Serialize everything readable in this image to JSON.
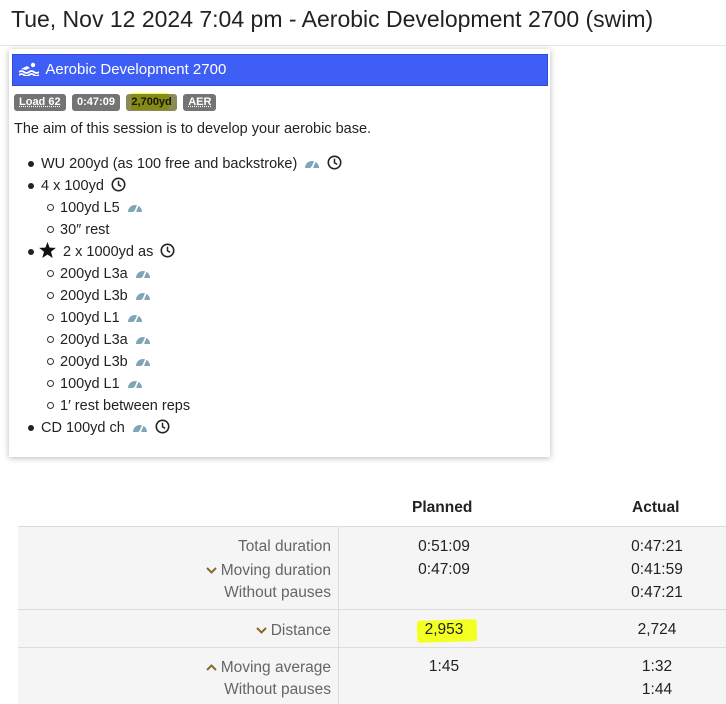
{
  "page": {
    "title": "Tue, Nov 12 2024 7:04 pm - Aerobic Development 2700 (swim)"
  },
  "workout": {
    "header_title": "Aerobic Development 2700",
    "header_icon": "swimmer-icon",
    "header_color": "#3f5ef5",
    "badges": {
      "load": "Load 62",
      "duration": "0:47:09",
      "distance": "2,700yd",
      "type": "AER"
    },
    "aim": "The aim of this session is to develop your aerobic base.",
    "steps": {
      "wu": "WU 200yd (as 100 free and backstroke)",
      "set1": "4 x 100yd",
      "set1_a": "100yd L5",
      "set1_b": "30″ rest",
      "set2": "2 x 1000yd as",
      "set2_a": "200yd L3a",
      "set2_b": "200yd L3b",
      "set2_c": "100yd L1",
      "set2_d": "200yd L3a",
      "set2_e": "200yd L3b",
      "set2_f": "100yd L1",
      "set2_g": "1′ rest between reps",
      "cd": "CD 100yd ch"
    }
  },
  "stats": {
    "planned_label": "Planned",
    "actual_label": "Actual",
    "total_duration_label": "Total duration",
    "total_duration_planned": "0:51:09",
    "total_duration_actual": "0:47:21",
    "moving_duration_label": "Moving duration",
    "moving_duration_planned": "0:47:09",
    "moving_duration_actual": "0:41:59",
    "without_pauses_label": "Without pauses",
    "without_pauses_actual": "0:47:21",
    "distance_label": "Distance",
    "distance_planned": "2,953",
    "distance_actual": "2,724",
    "moving_average_label": "Moving average",
    "moving_average_planned": "1:45",
    "moving_average_actual": "1:32",
    "avg_without_pauses_label": "Without pauses",
    "avg_without_pauses_actual": "1:44"
  },
  "colors": {
    "highlight": "#f4ff22",
    "chevron": "#8a6a2a",
    "gauge": "#7fa6b8"
  }
}
